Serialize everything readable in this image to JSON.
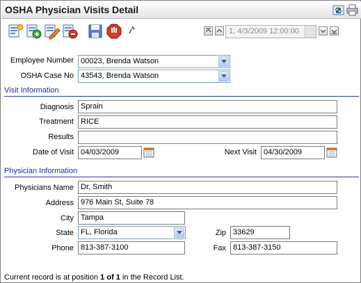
{
  "window": {
    "title": "OSHA Physician Visits Detail"
  },
  "titlebar_icons": [
    "refresh-icon",
    "print-icon"
  ],
  "toolbar": {
    "buttons": [
      "new-record-icon",
      "add-record-icon",
      "edit-record-icon",
      "delete-record-icon",
      "save-icon",
      "stop-icon",
      "pin-icon"
    ]
  },
  "navigation": {
    "record_selector": "1, 4/3/2009 12:00:00"
  },
  "employee": {
    "employee_number_label": "Employee Number",
    "employee_number_value": "00023, Brenda Watson",
    "osha_case_label": "OSHA Case No",
    "osha_case_value": "43543, Brenda Watson"
  },
  "visit": {
    "section_title": "Visit Information",
    "diagnosis_label": "Diagnosis",
    "diagnosis_value": "Sprain",
    "treatment_label": "Treatment",
    "treatment_value": "RICE",
    "results_label": "Results",
    "results_value": "",
    "date_label": "Date of Visit",
    "date_value": "04/03/2009",
    "next_label": "Next Visit",
    "next_value": "04/30/2009"
  },
  "physician": {
    "section_title": "Physician Information",
    "name_label": "Physicians Name",
    "name_value": "Dr. Smith",
    "address_label": "Address",
    "address_value": "976 Main St, Suite 78",
    "city_label": "City",
    "city_value": "Tampa",
    "state_label": "State",
    "state_value": "FL, Florida",
    "zip_label": "Zip",
    "zip_value": "33629",
    "phone_label": "Phone",
    "phone_value": "813-387-3100",
    "fax_label": "Fax",
    "fax_value": "813-387-3150"
  },
  "status": {
    "prefix": "Current record is at position ",
    "position": "1 of 1",
    "suffix": " in the Record List."
  },
  "colors": {
    "section_text": "#1c2f9a",
    "section_rule": "#2a3a8e"
  }
}
